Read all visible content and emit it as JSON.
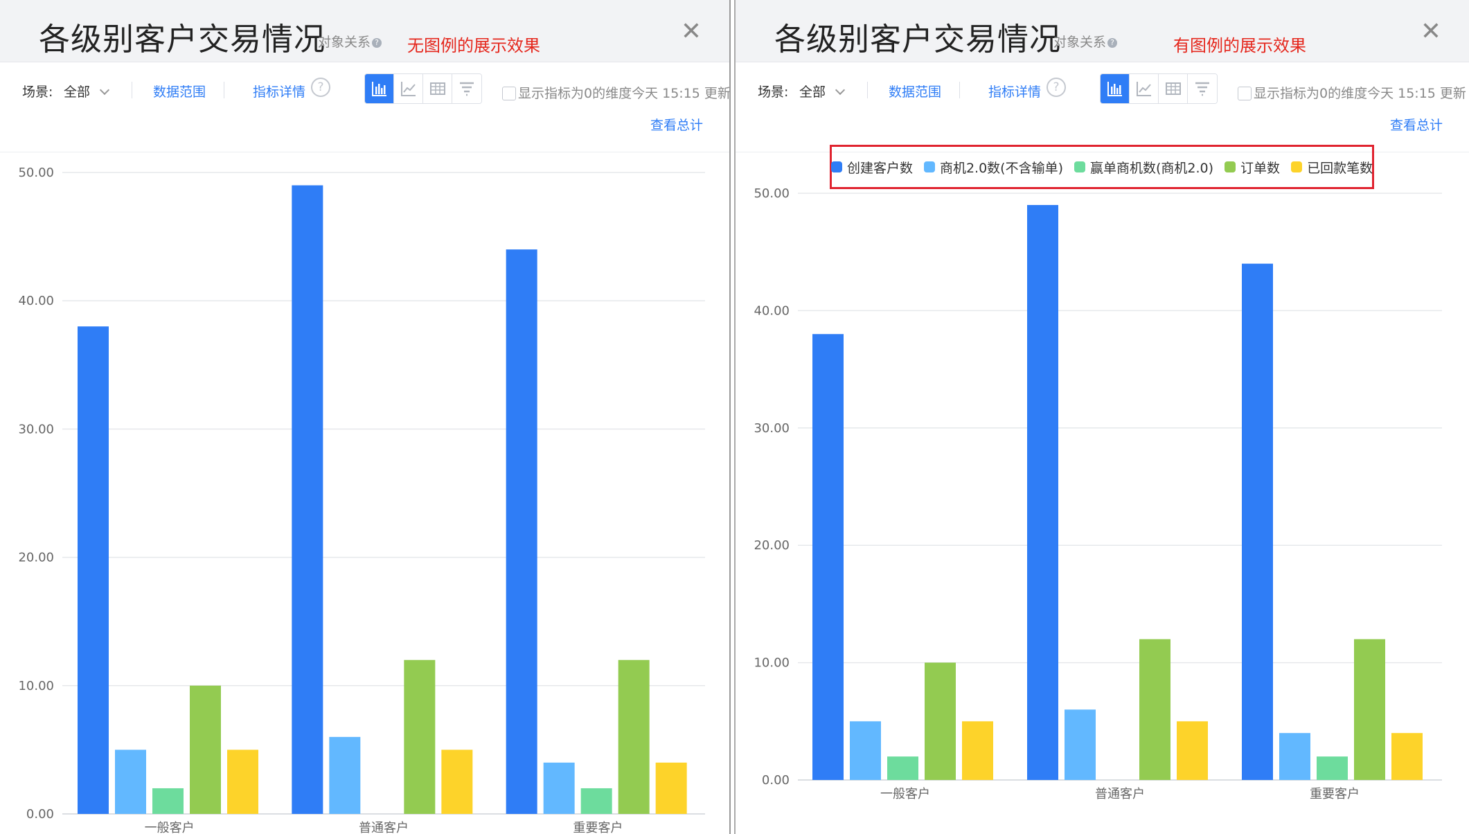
{
  "panels": [
    {
      "title": "各级别客户交易情况",
      "object_relation": "对象关系",
      "object_relation_icon": "question-dot-icon",
      "note": "无图例的展示效果",
      "close_icon": "close-icon",
      "scene_label": "场景:",
      "scene_value": "全部",
      "data_range": "数据范围",
      "indicator_details": "指标详情",
      "help_glyph": "?",
      "checkbox_label": "显示指标为0的维度今天 15:15 更新",
      "view_total": "查看总计",
      "legend_visible": false
    },
    {
      "title": "各级别客户交易情况",
      "object_relation": "对象关系",
      "object_relation_icon": "question-dot-icon",
      "note": "有图例的展示效果",
      "close_icon": "close-icon",
      "scene_label": "场景:",
      "scene_value": "全部",
      "data_range": "数据范围",
      "indicator_details": "指标详情",
      "help_glyph": "?",
      "checkbox_label": "显示指标为0的维度今天 15:15 更新",
      "view_total": "查看总计",
      "legend_visible": true
    }
  ],
  "view_buttons": [
    {
      "icon": "bar-chart-icon",
      "active": true
    },
    {
      "icon": "line-chart-icon",
      "active": false
    },
    {
      "icon": "table-icon",
      "active": false
    },
    {
      "icon": "funnel-icon",
      "active": false
    }
  ],
  "colors": {
    "accent": "#2f7df6",
    "note_red": "#e5261c",
    "series": [
      "#2f7df6",
      "#62b8ff",
      "#6ddc9d",
      "#93cb51",
      "#fdd32a"
    ]
  },
  "chart_data": [
    {
      "type": "bar",
      "categories": [
        "一般客户",
        "普通客户",
        "重要客户"
      ],
      "series": [
        {
          "name": "创建客户数",
          "values": [
            38,
            49,
            44
          ]
        },
        {
          "name": "商机2.0数(不含输单)",
          "values": [
            5,
            6,
            4
          ]
        },
        {
          "name": "赢单商机数(商机2.0)",
          "values": [
            2,
            0,
            2
          ]
        },
        {
          "name": "订单数",
          "values": [
            10,
            12,
            12
          ]
        },
        {
          "name": "已回款笔数",
          "values": [
            5,
            5,
            4
          ]
        }
      ],
      "yticks": [
        "0.00",
        "10.00",
        "20.00",
        "30.00",
        "40.00",
        "50.00"
      ],
      "ylim": [
        0,
        50
      ],
      "grid": true,
      "legend": "none"
    },
    {
      "type": "bar",
      "categories": [
        "一般客户",
        "普通客户",
        "重要客户"
      ],
      "series": [
        {
          "name": "创建客户数",
          "values": [
            38,
            49,
            44
          ]
        },
        {
          "name": "商机2.0数(不含输单)",
          "values": [
            5,
            6,
            4
          ]
        },
        {
          "name": "赢单商机数(商机2.0)",
          "values": [
            2,
            0,
            2
          ]
        },
        {
          "name": "订单数",
          "values": [
            10,
            12,
            12
          ]
        },
        {
          "name": "已回款笔数",
          "values": [
            5,
            5,
            4
          ]
        }
      ],
      "yticks": [
        "0.00",
        "10.00",
        "20.00",
        "30.00",
        "40.00",
        "50.00"
      ],
      "ylim": [
        0,
        50
      ],
      "grid": true,
      "legend": "top"
    }
  ]
}
